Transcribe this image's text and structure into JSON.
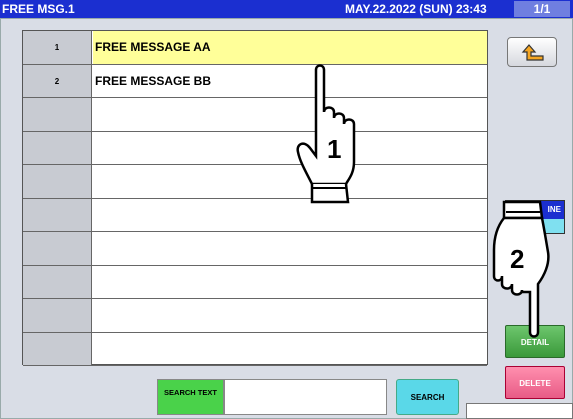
{
  "title": {
    "screen": "FREE MSG.1",
    "datetime": "MAY.22.2022 (SUN)  23:43",
    "page": "1/1"
  },
  "list": [
    {
      "num": "1",
      "text": "FREE MESSAGE AA",
      "selected": true
    },
    {
      "num": "2",
      "text": "FREE MESSAGE BB",
      "selected": false
    },
    {
      "num": "",
      "text": "",
      "selected": false
    },
    {
      "num": "",
      "text": "",
      "selected": false
    },
    {
      "num": "",
      "text": "",
      "selected": false
    },
    {
      "num": "",
      "text": "",
      "selected": false
    },
    {
      "num": "",
      "text": "",
      "selected": false
    },
    {
      "num": "",
      "text": "",
      "selected": false
    },
    {
      "num": "",
      "text": "",
      "selected": false
    },
    {
      "num": "",
      "text": "",
      "selected": false
    }
  ],
  "buttons": {
    "line_partial": "INE",
    "detail": "DETAIL",
    "delete": "DELETE",
    "search_text_label": "SEARCH TEXT",
    "search": "SEARCH"
  },
  "search_value": "",
  "annotations": {
    "step1": "1",
    "step2": "2"
  },
  "icons": {
    "back": "return-arrow-icon",
    "hand": "pointing-hand-icon"
  },
  "colors": {
    "titlebar": "#1b2fd0",
    "selected_row": "#ffff99",
    "detail": "#3a993a",
    "delete": "#e85b86",
    "search": "#5ad8e8",
    "search_label": "#4ad24a"
  }
}
